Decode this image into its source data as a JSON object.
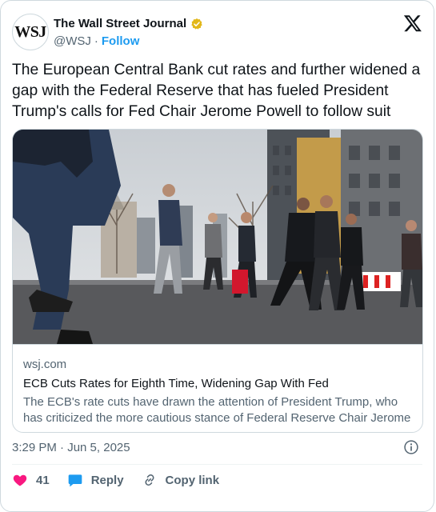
{
  "account": {
    "avatar_text": "WSJ",
    "display_name": "The Wall Street Journal",
    "handle": "@WSJ",
    "separator": "·",
    "follow_label": "Follow"
  },
  "icons": {
    "verified": "gold-verified-badge-icon",
    "platform": "x-logo-icon",
    "info": "info-icon",
    "like": "heart-icon",
    "reply": "reply-bubble-icon",
    "copy": "link-icon"
  },
  "tweet": {
    "text": "The European Central Bank cut rates and further widened a gap with the Federal Reserve that has fueled President Trump's calls for Fed Chair Jerome Powell to follow suit",
    "timestamp": "3:29 PM · Jun 5, 2025"
  },
  "link_card": {
    "domain": "wsj.com",
    "title": "ECB Cuts Rates for Eighth Time, Widening Gap With Fed",
    "description": "The ECB's rate cuts have drawn the attention of President Trump, who has criticized the more cautious stance of Federal Reserve Chair Jerome ..."
  },
  "actions": {
    "like_count": "41",
    "reply_label": "Reply",
    "copy_link_label": "Copy link"
  },
  "colors": {
    "accent": "#1d9bf0",
    "like": "#f91880",
    "verified_gold": "#e2b719",
    "muted": "#536471",
    "border": "#cfd9de"
  }
}
